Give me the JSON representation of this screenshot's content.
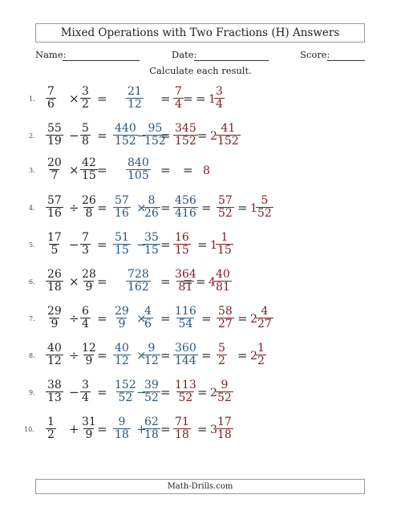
{
  "title": "Mixed Operations with Two Fractions (H) Answers",
  "name_label": "Name:",
  "date_label": "Date:",
  "score_label": "Score:",
  "instructions": "Calculate each result.",
  "footer": "Math-Drills.com",
  "problems": [
    {
      "num": "1.",
      "a": [
        "7",
        "6"
      ],
      "op": "×",
      "b": [
        "3",
        "2"
      ],
      "step1": null,
      "step2": [
        "21",
        "12"
      ],
      "simp": [
        "7",
        "4"
      ],
      "mixed": {
        "w": "1",
        "n": "3",
        "d": "4"
      }
    },
    {
      "num": "2.",
      "a": [
        "55",
        "19"
      ],
      "op": "−",
      "b": [
        "5",
        "8"
      ],
      "step1": {
        "a": [
          "440",
          "152"
        ],
        "op": "−",
        "b": [
          "95",
          "152"
        ]
      },
      "step2": null,
      "simp": [
        "345",
        "152"
      ],
      "mixed": {
        "w": "2",
        "n": "41",
        "d": "152"
      }
    },
    {
      "num": "3.",
      "a": [
        "20",
        "7"
      ],
      "op": "×",
      "b": [
        "42",
        "15"
      ],
      "step1": null,
      "step2": [
        "840",
        "105"
      ],
      "simp": null,
      "whole": "8",
      "mixed": null
    },
    {
      "num": "4.",
      "a": [
        "57",
        "16"
      ],
      "op": "÷",
      "b": [
        "26",
        "8"
      ],
      "step1": {
        "a": [
          "57",
          "16"
        ],
        "op": "×",
        "b": [
          "8",
          "26"
        ]
      },
      "step2": [
        "456",
        "416"
      ],
      "simp": [
        "57",
        "52"
      ],
      "mixed": {
        "w": "1",
        "n": "5",
        "d": "52"
      }
    },
    {
      "num": "5.",
      "a": [
        "17",
        "5"
      ],
      "op": "−",
      "b": [
        "7",
        "3"
      ],
      "step1": {
        "a": [
          "51",
          "15"
        ],
        "op": "−",
        "b": [
          "35",
          "15"
        ]
      },
      "step2": null,
      "simp": [
        "16",
        "15"
      ],
      "mixed": {
        "w": "1",
        "n": "1",
        "d": "15"
      }
    },
    {
      "num": "6.",
      "a": [
        "26",
        "18"
      ],
      "op": "×",
      "b": [
        "28",
        "9"
      ],
      "step1": null,
      "step2": [
        "728",
        "162"
      ],
      "simp": [
        "364",
        "81"
      ],
      "mixed": {
        "w": "4",
        "n": "40",
        "d": "81"
      }
    },
    {
      "num": "7.",
      "a": [
        "29",
        "9"
      ],
      "op": "÷",
      "b": [
        "6",
        "4"
      ],
      "step1": {
        "a": [
          "29",
          "9"
        ],
        "op": "×",
        "b": [
          "4",
          "6"
        ]
      },
      "step2": [
        "116",
        "54"
      ],
      "simp": [
        "58",
        "27"
      ],
      "mixed": {
        "w": "2",
        "n": "4",
        "d": "27"
      }
    },
    {
      "num": "8.",
      "a": [
        "40",
        "12"
      ],
      "op": "÷",
      "b": [
        "12",
        "9"
      ],
      "step1": {
        "a": [
          "40",
          "12"
        ],
        "op": "×",
        "b": [
          "9",
          "12"
        ]
      },
      "step2": [
        "360",
        "144"
      ],
      "simp": [
        "5",
        "2"
      ],
      "mixed": {
        "w": "2",
        "n": "1",
        "d": "2"
      }
    },
    {
      "num": "9.",
      "a": [
        "38",
        "13"
      ],
      "op": "−",
      "b": [
        "3",
        "4"
      ],
      "step1": {
        "a": [
          "152",
          "52"
        ],
        "op": "−",
        "b": [
          "39",
          "52"
        ]
      },
      "step2": null,
      "simp": [
        "113",
        "52"
      ],
      "mixed": {
        "w": "2",
        "n": "9",
        "d": "52"
      }
    },
    {
      "num": "10.",
      "a": [
        "1",
        "2"
      ],
      "op": "+",
      "b": [
        "31",
        "9"
      ],
      "step1": {
        "a": [
          "9",
          "18"
        ],
        "op": "+",
        "b": [
          "62",
          "18"
        ]
      },
      "step2": null,
      "simp": [
        "71",
        "18"
      ],
      "mixed": {
        "w": "3",
        "n": "17",
        "d": "18"
      }
    }
  ]
}
